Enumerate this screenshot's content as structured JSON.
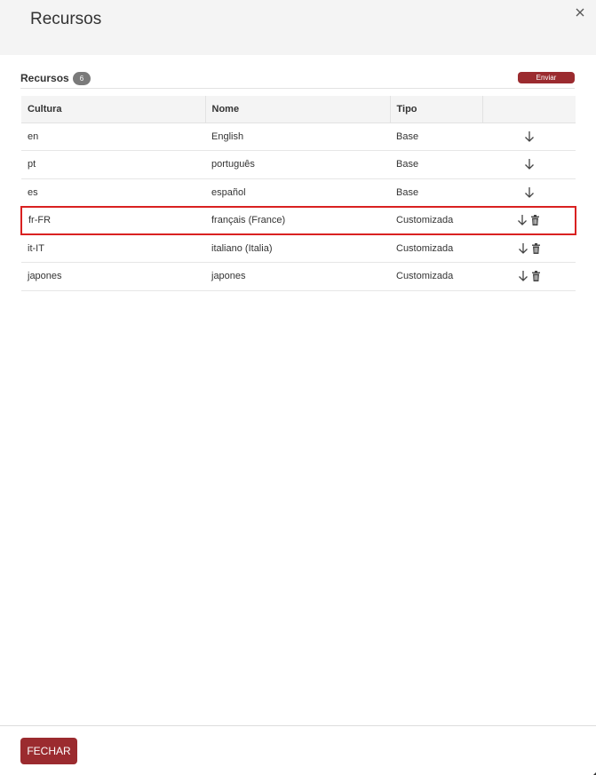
{
  "modal": {
    "title": "Recursos",
    "close_icon": "close-icon"
  },
  "section": {
    "title": "Recursos",
    "count": "6",
    "send_label": "Enviar"
  },
  "table": {
    "columns": [
      "Cultura",
      "Nome",
      "Tipo",
      ""
    ],
    "rows": [
      {
        "cultura": "en",
        "nome": "English",
        "tipo": "Base",
        "actions": [
          "download-icon"
        ]
      },
      {
        "cultura": "pt",
        "nome": "português",
        "tipo": "Base",
        "actions": [
          "download-icon"
        ]
      },
      {
        "cultura": "es",
        "nome": "español",
        "tipo": "Base",
        "actions": [
          "download-icon"
        ]
      },
      {
        "cultura": "fr-FR",
        "nome": "français (France)",
        "tipo": "Customizada",
        "actions": [
          "download-icon",
          "trash-icon"
        ],
        "selected": true
      },
      {
        "cultura": "it-IT",
        "nome": "italiano (Italia)",
        "tipo": "Customizada",
        "actions": [
          "download-icon",
          "trash-icon"
        ]
      },
      {
        "cultura": "japones",
        "nome": "japones",
        "tipo": "Customizada",
        "actions": [
          "download-icon",
          "trash-icon"
        ]
      }
    ]
  },
  "footer": {
    "close_label": "FECHAR"
  },
  "colors": {
    "accent": "#9b2b2f",
    "selection_border": "#d92121",
    "header_bg": "#f4f4f4"
  }
}
